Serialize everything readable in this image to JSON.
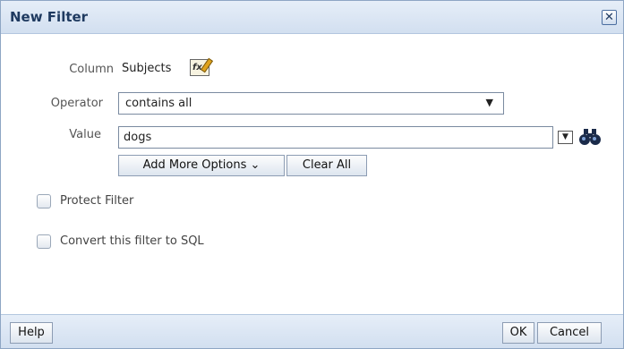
{
  "dialog": {
    "title": "New Filter",
    "close_label": "✕"
  },
  "form": {
    "column_label": "Column",
    "column_value": "Subjects",
    "edit_icon_text": "fx",
    "operator_label": "Operator",
    "operator_value": "contains all",
    "value_label": "Value",
    "value_input": "dogs",
    "add_more_options_label": "Add More Options ⌄",
    "clear_all_label": "Clear All",
    "protect_filter_label": "Protect Filter",
    "convert_sql_label": "Convert this filter to SQL"
  },
  "footer": {
    "help_label": "Help",
    "ok_label": "OK",
    "cancel_label": "Cancel"
  },
  "colors": {
    "titlebar": "#d2dff0",
    "title_text": "#1f3a60",
    "border": "#8ea6c4"
  }
}
